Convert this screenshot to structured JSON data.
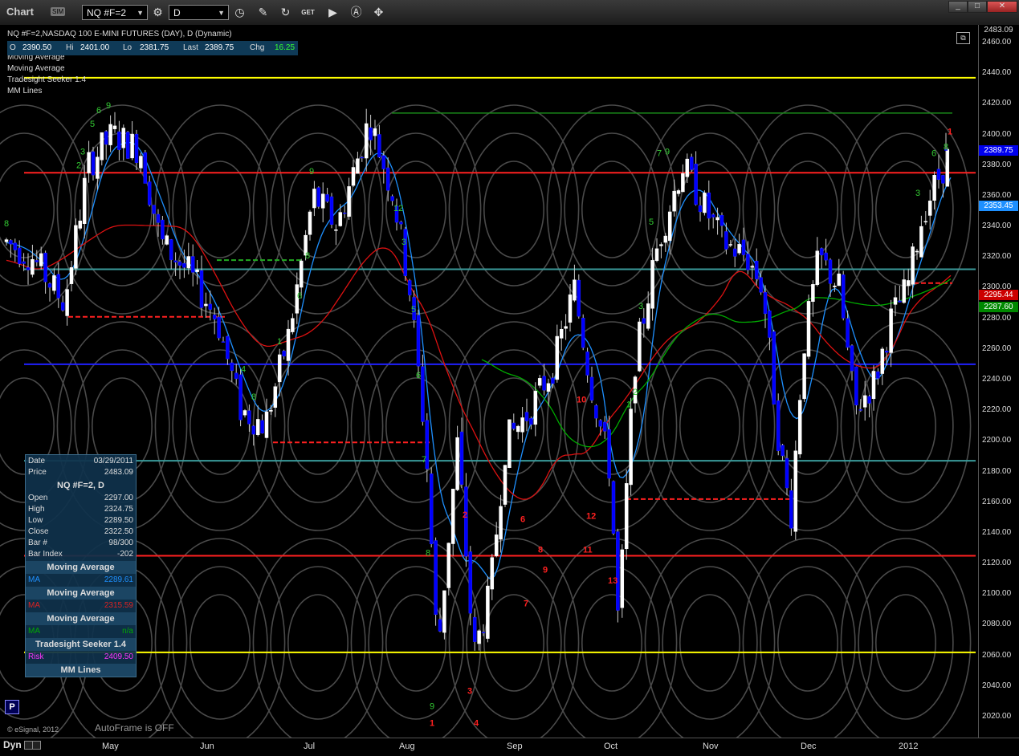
{
  "toolbar": {
    "title": "Chart",
    "sim_badge": "SIM",
    "symbol": "NQ #F=2",
    "interval": "D",
    "icons": [
      "link-icon",
      "pencil-icon",
      "cycle-icon",
      "get-icon",
      "play-icon",
      "draw-tool-icon",
      "cursor-icon"
    ]
  },
  "chart_info": {
    "title": "NQ #F=2,NASDAQ 100 E-MINI FUTURES (DAY), D (Dynamic)",
    "legend": [
      "Moving Average",
      "Moving Average",
      "Moving Average",
      "Tradesight Seeker 1.4",
      "MM Lines"
    ]
  },
  "quote": {
    "o_label": "O",
    "open": "2390.50",
    "h_label": "Hi",
    "high": "2401.00",
    "l_label": "Lo",
    "low": "2381.75",
    "last_label": "Last",
    "last": "2389.75",
    "chg_label": "Chg",
    "chg": "16.25"
  },
  "data_window": {
    "date_label": "Date",
    "date": "03/29/2011",
    "price_label": "Price",
    "price": "2483.09",
    "symbol": "NQ #F=2, D",
    "open_label": "Open",
    "open": "2297.00",
    "high_label": "High",
    "high": "2324.75",
    "low_label": "Low",
    "low": "2289.50",
    "close_label": "Close",
    "close": "2322.50",
    "bar_label": "Bar #",
    "bar": "98/300",
    "bar_index_label": "Bar Index",
    "bar_index": "-202",
    "ma1_head": "Moving Average",
    "ma1_label": "MA",
    "ma1": "2289.61",
    "ma2_head": "Moving Average",
    "ma2_label": "MA",
    "ma2": "2315.59",
    "ma3_head": "Moving Average",
    "ma3_label": "MA",
    "ma3": "n/a",
    "seeker_head": "Tradesight Seeker 1.4",
    "risk_label": "Risk",
    "risk": "2409.50",
    "mm_head": "MM Lines"
  },
  "price_axis": {
    "labels": [
      "2460.00",
      "2440.00",
      "2420.00",
      "2400.00",
      "2380.00",
      "2360.00",
      "2340.00",
      "2320.00",
      "2300.00",
      "2280.00",
      "2260.00",
      "2240.00",
      "2220.00",
      "2200.00",
      "2180.00",
      "2160.00",
      "2140.00",
      "2120.00",
      "2100.00",
      "2080.00",
      "2060.00",
      "2040.00",
      "2020.00"
    ],
    "top_tag": "2483.09",
    "tags": [
      {
        "value": "2389.75",
        "color": "#0000ee"
      },
      {
        "value": "2353.45",
        "color": "#1e90ff"
      },
      {
        "value": "2295.44",
        "color": "#cc0000"
      },
      {
        "value": "2287.60",
        "color": "#008800"
      }
    ]
  },
  "time_axis": {
    "labels": [
      "May",
      "Jun",
      "Jul",
      "Aug",
      "Sep",
      "Oct",
      "Nov",
      "Dec",
      "2012"
    ]
  },
  "footer": {
    "dyn": "Dyn",
    "p_button": "P",
    "copyright": "© eSignal, 2012",
    "autoframe": "AutoFrame is OFF"
  },
  "chart_data": {
    "type": "candlestick",
    "title": "NQ #F=2,NASDAQ 100 E-MINI FUTURES (DAY), D (Dynamic)",
    "ylim": [
      2010,
      2485
    ],
    "y_ticks": [
      2020,
      2040,
      2060,
      2080,
      2100,
      2120,
      2140,
      2160,
      2180,
      2200,
      2220,
      2240,
      2260,
      2280,
      2300,
      2320,
      2340,
      2360,
      2380,
      2400,
      2420,
      2440,
      2460
    ],
    "x_labels": [
      "May",
      "Jun",
      "Jul",
      "Aug",
      "Sep",
      "Oct",
      "Nov",
      "Dec",
      "2012"
    ],
    "last_candle": {
      "open": 2390.5,
      "high": 2401.0,
      "low": 2381.75,
      "close": 2389.75
    },
    "mm_lines": [
      {
        "level": 2437,
        "color": "#ffff00"
      },
      {
        "level": 2375,
        "color": "#ff2020"
      },
      {
        "level": 2312,
        "color": "#3a9a9a"
      },
      {
        "level": 2250,
        "color": "#2020ff"
      },
      {
        "level": 2187,
        "color": "#3a9a9a"
      },
      {
        "level": 2125,
        "color": "#ff2020"
      },
      {
        "level": 2062,
        "color": "#ffff00"
      }
    ],
    "moving_averages": [
      {
        "label": "MA",
        "value": 2353.45,
        "color": "#1e90ff"
      },
      {
        "label": "MA",
        "value": 2295.44,
        "color": "#cc0000"
      },
      {
        "label": "MA",
        "value": 2287.6,
        "color": "#00aa00"
      }
    ],
    "last": 2389.75,
    "colors": {
      "up": "#ffffff",
      "down": "#0000ff",
      "grid_circles": "#555555"
    }
  }
}
